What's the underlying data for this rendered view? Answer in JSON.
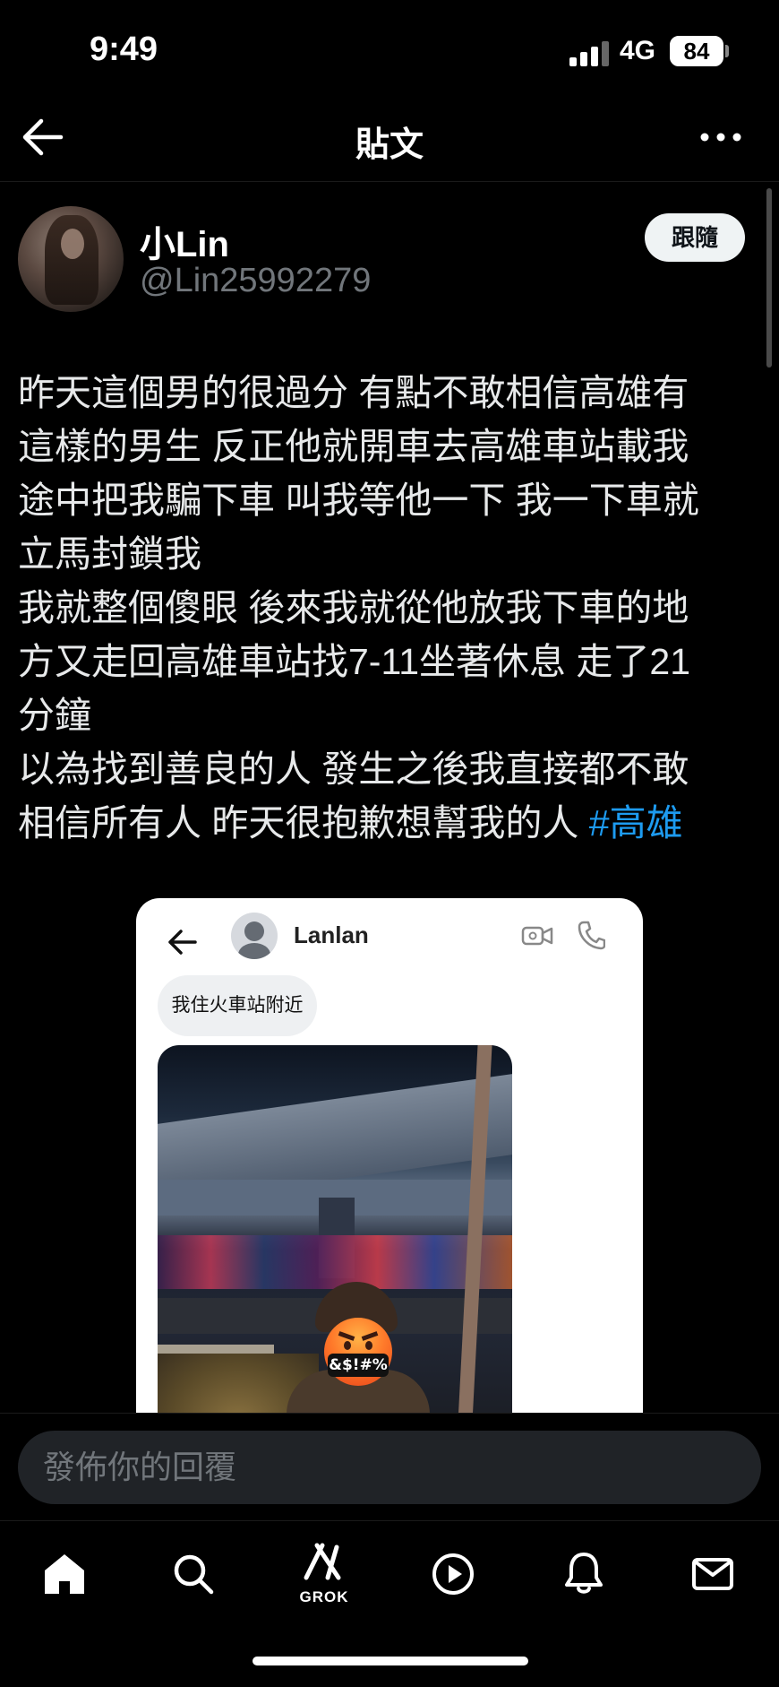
{
  "status_bar": {
    "time": "9:49",
    "network": "4G",
    "battery": "84"
  },
  "header": {
    "title": "貼文",
    "back_icon": "arrow-left-icon",
    "more_icon": "ellipsis-icon"
  },
  "post": {
    "author": {
      "name": "小Lin",
      "handle": "@Lin25992279"
    },
    "follow_label": "跟隨",
    "text_lines": [
      "昨天這個男的很過分 有點不敢相信高雄有",
      "這樣的男生 反正他就開車去高雄車站載我",
      "途中把我騙下車 叫我等他一下 我一下車就",
      "立馬封鎖我",
      "我就整個傻眼 後來我就從他放我下車的地",
      "方又走回高雄車站找7-11坐著休息 走了21",
      "分鐘",
      "以為找到善良的人 發生之後我直接都不敢"
    ],
    "last_line_text": "相信所有人 昨天很抱歉想幫我的人 ",
    "hashtag": "#高雄"
  },
  "embedded_screenshot": {
    "contact_name": "Lanlan",
    "message": "我住火車站附近",
    "emoji_overlay_text": "&$!#%"
  },
  "reply": {
    "placeholder": "發佈你的回覆"
  },
  "bottom_nav": {
    "items": [
      "home-icon",
      "search-icon",
      "grok-icon",
      "play-icon",
      "bell-icon",
      "mail-icon"
    ],
    "grok_label": "GROK"
  },
  "colors": {
    "background": "#000000",
    "text": "#e7e9ea",
    "muted": "#71767b",
    "link": "#1d9bf0"
  }
}
